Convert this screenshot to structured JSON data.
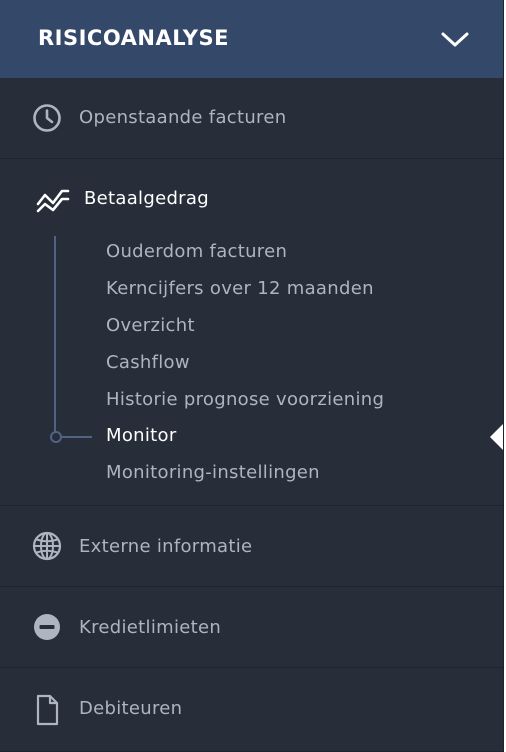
{
  "header": {
    "title": "RISICOANALYSE"
  },
  "nav": {
    "open_invoices": "Openstaande facturen",
    "payment_behaviour": "Betaalgedrag",
    "external_info": "Externe informatie",
    "credit_limits": "Kredietlimieten",
    "debtors": "Debiteuren"
  },
  "submenu": {
    "items": [
      "Ouderdom facturen",
      "Kerncijfers over 12 maanden",
      "Overzicht",
      "Cashflow",
      "Historie prognose voorziening",
      "Monitor",
      "Monitoring-instellingen"
    ],
    "active_index": 5
  },
  "icons": {
    "header": "chevron-down-icon",
    "open_invoices": "clock-icon",
    "payment_behaviour": "trend-chart-icon",
    "external_info": "globe-icon",
    "credit_limits": "minus-circle-icon",
    "debtors": "document-icon"
  },
  "colors": {
    "header_bg": "#34486a",
    "sidebar_bg": "#272d39",
    "text_muted": "#aeb4c0",
    "text_active": "#ffffff",
    "tree_line": "#4f6385"
  }
}
